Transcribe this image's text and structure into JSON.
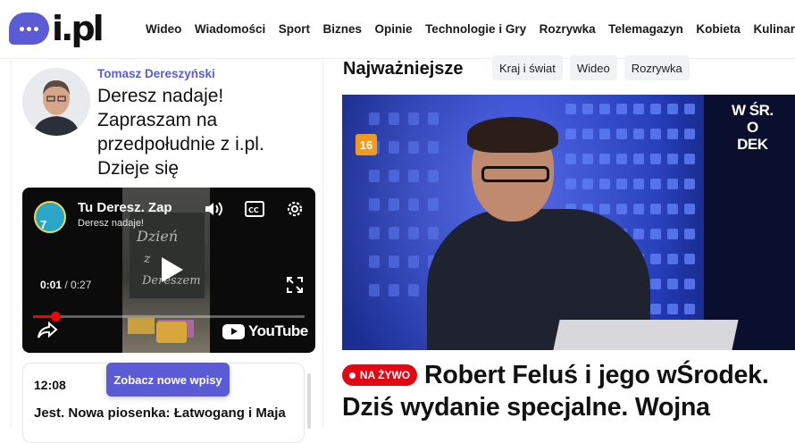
{
  "brand": {
    "logo_text": "i.pl",
    "accent": "#5b5bd6"
  },
  "nav": {
    "items": [
      "Wideo",
      "Wiadomości",
      "Sport",
      "Biznes",
      "Opinie",
      "Technologie i Gry",
      "Rozrywka",
      "Telemagazyn",
      "Kobieta",
      "Kulinaria"
    ]
  },
  "live_post": {
    "author": "Tomasz Dereszyński",
    "title": "Deresz nadaje! Zapraszam na przedpołudnie z i.pl. Dzieje się"
  },
  "video": {
    "title": "Tu Deresz. Zap",
    "subtitle": "Deresz nadaje!",
    "channel_badge": "7",
    "current_time": "0:01",
    "duration": " / 0:27",
    "progress_fraction": 0.083,
    "platform": "YouTube",
    "icons": [
      "volume-icon",
      "captions-icon",
      "settings-icon",
      "play-icon",
      "fullscreen-icon",
      "share-icon"
    ]
  },
  "feed": {
    "time": "12:08",
    "text": "Jest. Nowa piosenka: Łatwogang i Maja",
    "new_posts_label": "Zobacz nowe wpisy"
  },
  "section": {
    "title": "Najważniejsze",
    "chips": [
      "Kraj i świat",
      "Wideo",
      "Rozrywka"
    ]
  },
  "hero": {
    "age_rating": "16",
    "show_logo": "W ŚR.\nO\nDEK",
    "live_label": "NA ŻYWO",
    "live_color": "#e30613",
    "headline": "Robert Feluś i jego wŚrodek. Dziś wydanie specjalne. Wojna"
  }
}
